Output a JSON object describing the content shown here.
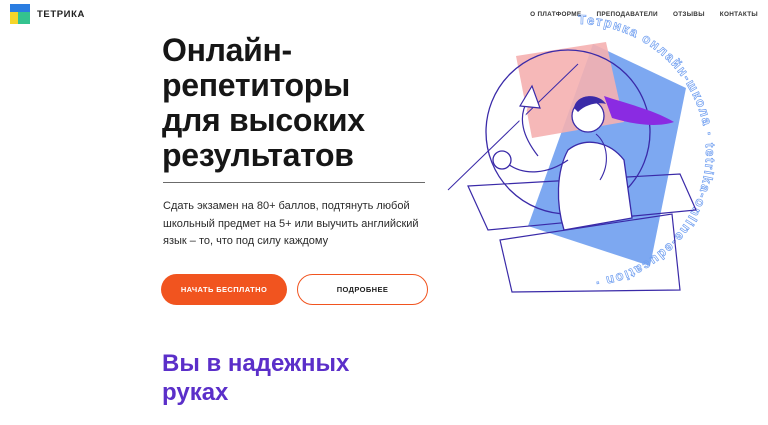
{
  "brand": {
    "name": "ТЕТРИКА"
  },
  "nav": {
    "items": [
      {
        "label": "О ПЛАТФОРМЕ"
      },
      {
        "label": "ПРЕПОДАВАТЕЛИ"
      },
      {
        "label": "ОТЗЫВЫ"
      },
      {
        "label": "КОНТАКТЫ"
      }
    ]
  },
  "hero": {
    "title_lines": [
      "Онлайн-",
      "репетиторы",
      "для высоких",
      "результатов"
    ],
    "subtitle": "Сдать экзамен на 80+ баллов, подтянуть любой школьный предмет на 5+ или выучить английский язык – то, что под силу каждому",
    "primary_button": "НАЧАТЬ БЕСПЛАТНО",
    "secondary_button": "ПОДРОБНЕЕ"
  },
  "illustration": {
    "ring_text": "Тетрика онлайн-школа · tetrika-online-education · "
  },
  "section": {
    "title_lines": [
      "Вы в надежных",
      "руках"
    ]
  },
  "colors": {
    "accent": "#f1541f",
    "purple": "#5b2fc9",
    "blue_triangle": "#6f9ef0",
    "pink_square": "#f5b0b0",
    "outline": "#3a2aa8",
    "hair": "#8a2be2"
  }
}
